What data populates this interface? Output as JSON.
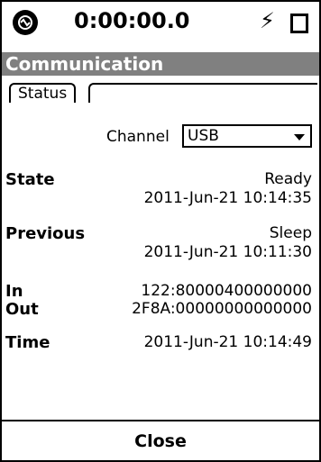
{
  "statusbar": {
    "timer": "0:00:00.0",
    "flash_glyph": "⚡",
    "icons": [
      "app-menu-icon",
      "flash-icon",
      "battery-icon"
    ]
  },
  "window": {
    "title": "Communication"
  },
  "tabs": [
    {
      "label": "Status",
      "selected": true
    }
  ],
  "channel": {
    "label": "Channel",
    "value": "USB"
  },
  "state": {
    "label": "State",
    "status": "Ready",
    "timestamp": "2011-Jun-21 10:14:35"
  },
  "previous": {
    "label": "Previous",
    "status": "Sleep",
    "timestamp": "2011-Jun-21 10:11:30"
  },
  "in": {
    "label": "In",
    "value": "122:80000400000000"
  },
  "out": {
    "label": "Out",
    "value": "2F8A:00000000000000"
  },
  "time": {
    "label": "Time",
    "value": "2011-Jun-21 10:14:49"
  },
  "footer": {
    "close_label": "Close"
  },
  "colors": {
    "title_bar": "#808080",
    "text": "#000000",
    "background": "#ffffff"
  }
}
